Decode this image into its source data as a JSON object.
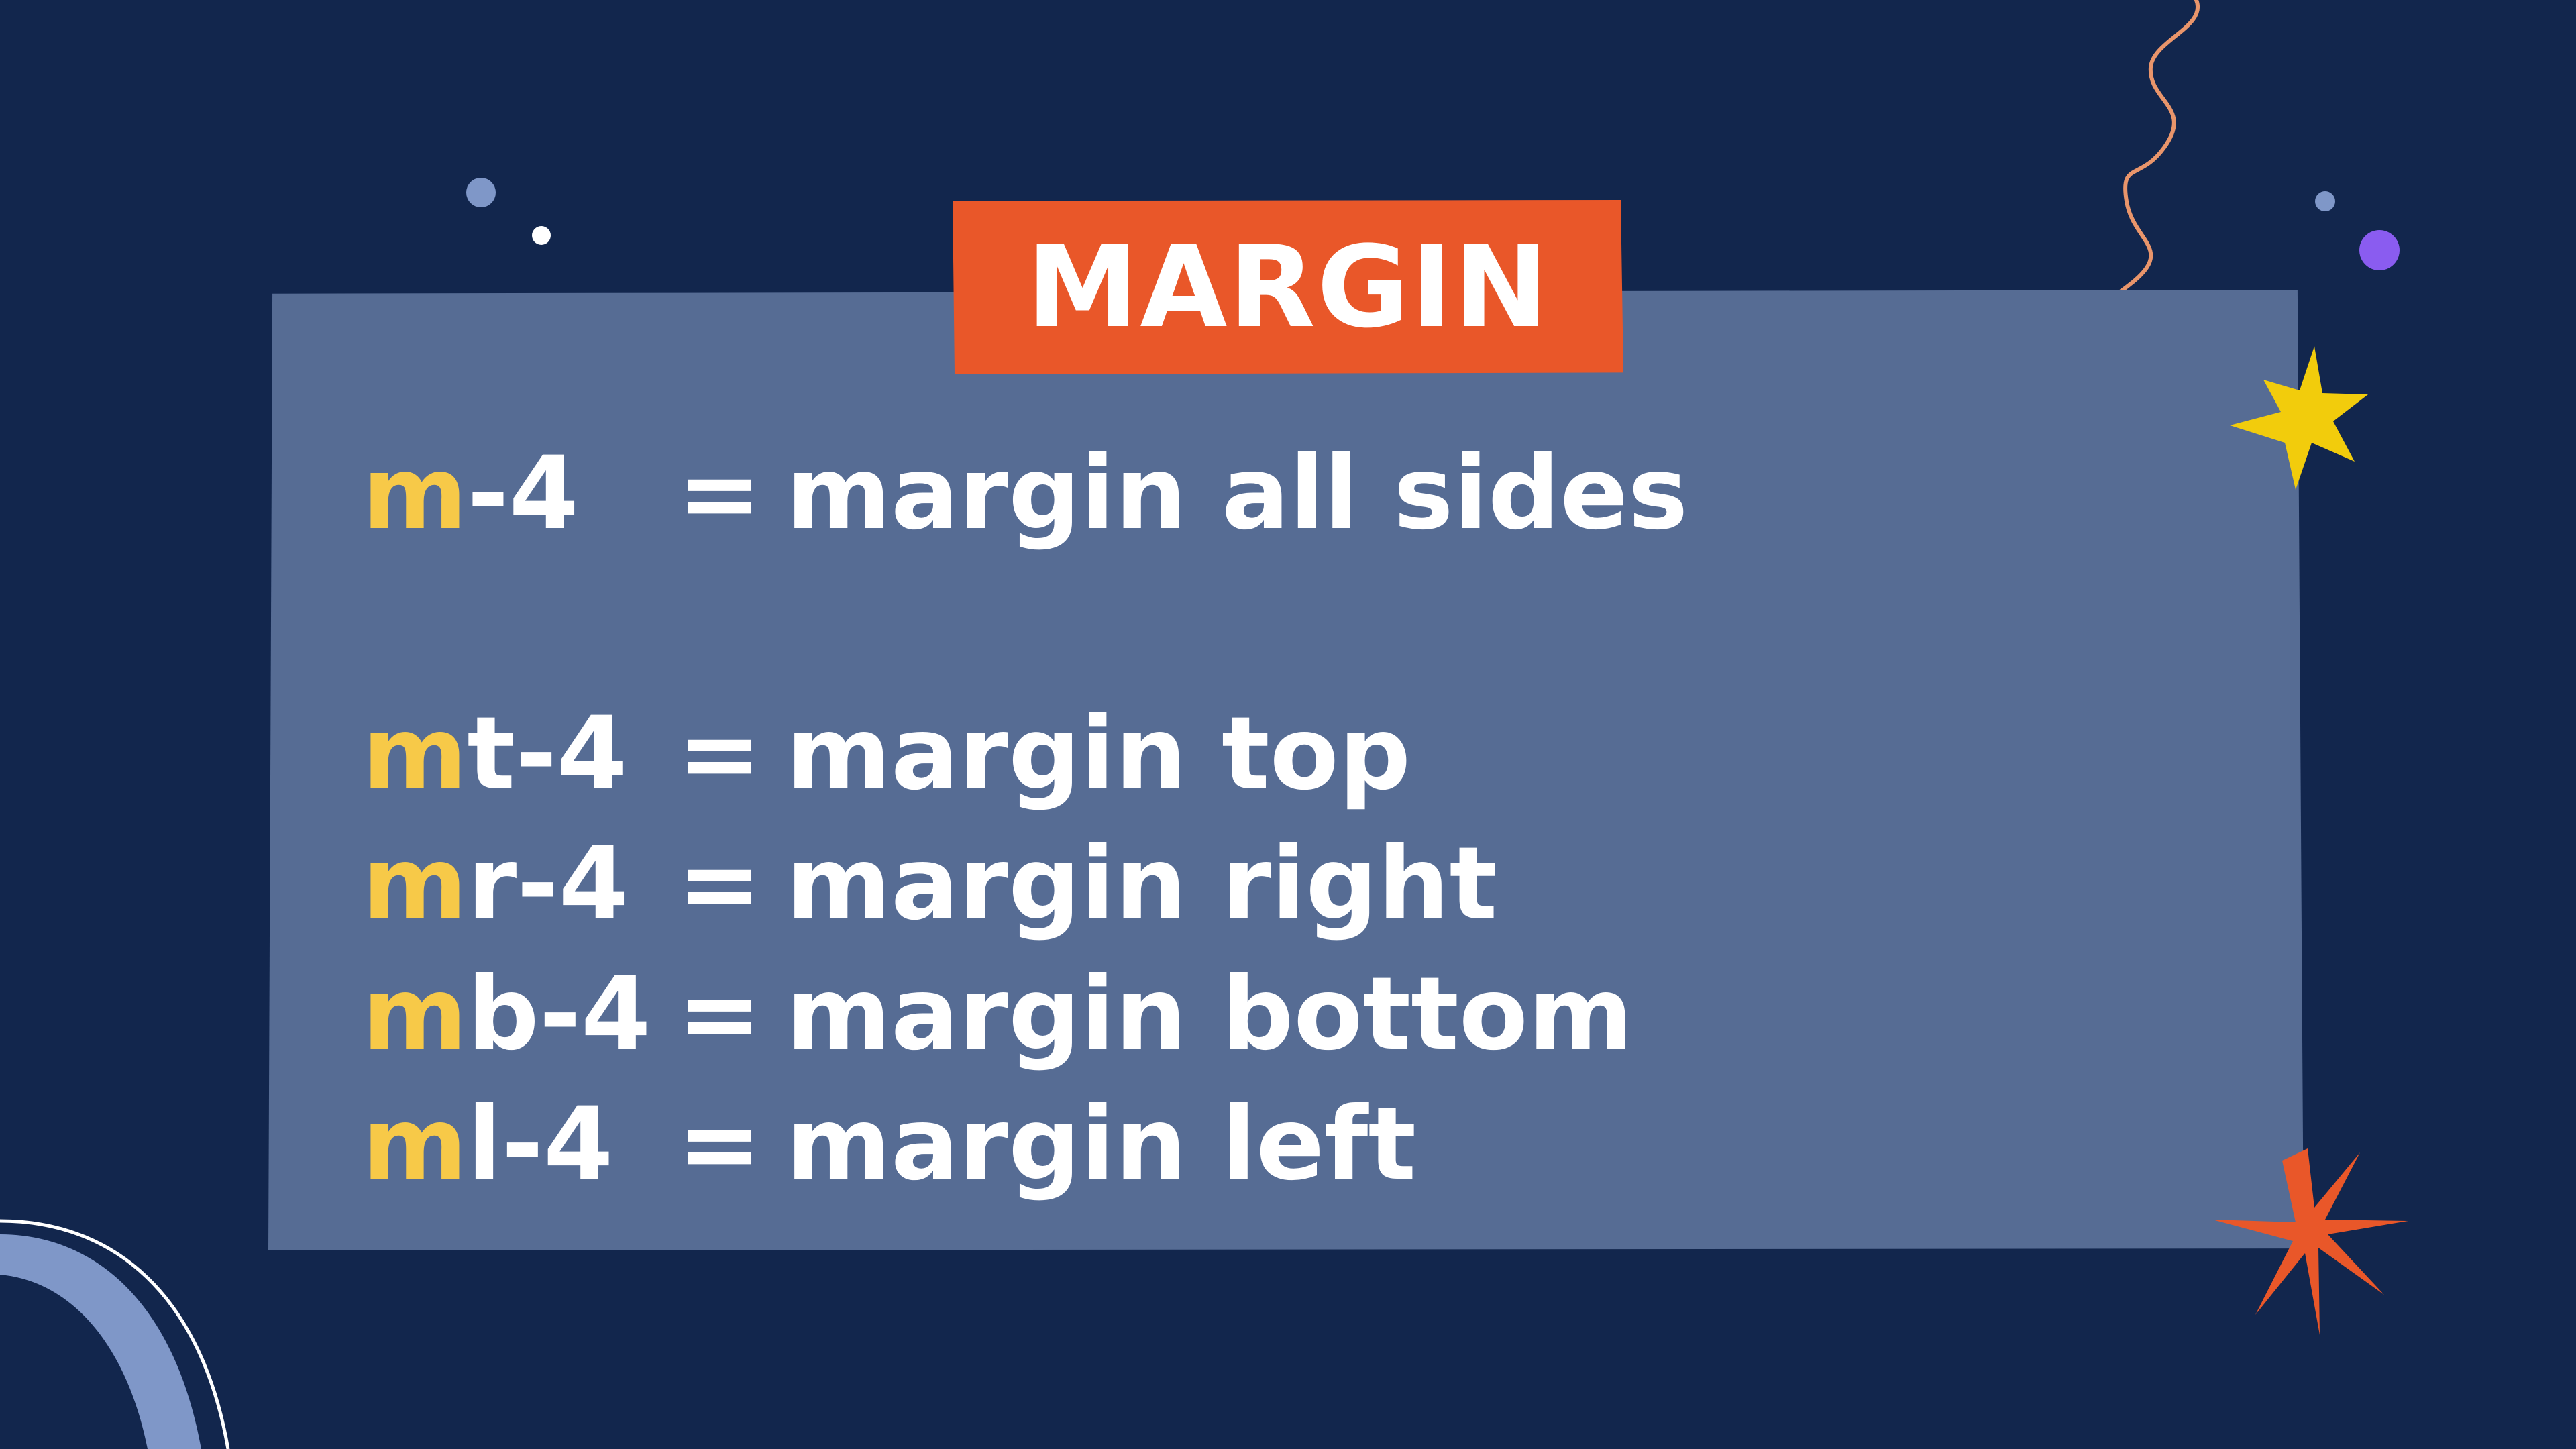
{
  "slide": {
    "title": "MARGIN",
    "rows": [
      {
        "prefix": "m",
        "suffix": "-4",
        "equals": "=",
        "description": "margin all sides"
      },
      {
        "prefix": "m",
        "suffix": "t-4",
        "equals": "=",
        "description": "margin top"
      },
      {
        "prefix": "m",
        "suffix": "r-4",
        "equals": "=",
        "description": "margin right"
      },
      {
        "prefix": "m",
        "suffix": "b-4",
        "equals": "=",
        "description": "margin bottom"
      },
      {
        "prefix": "m",
        "suffix": "l-4",
        "equals": "=",
        "description": "margin left"
      }
    ]
  },
  "colors": {
    "background": "#12264d",
    "panel": "#566c94",
    "title_tag": "#e95729",
    "highlight": "#f7c948",
    "text": "#ffffff",
    "star_yellow": "#f2cc0c",
    "star_orange": "#e95729",
    "squiggle": "#e9956b",
    "dot_purple": "#8a5cf0",
    "dot_blue": "#7f97c8",
    "arc": "#7f97c8"
  },
  "decorations": {
    "icons": [
      "dot-icon",
      "squiggle-icon",
      "star-icon",
      "starburst-icon",
      "arc-icon"
    ]
  }
}
